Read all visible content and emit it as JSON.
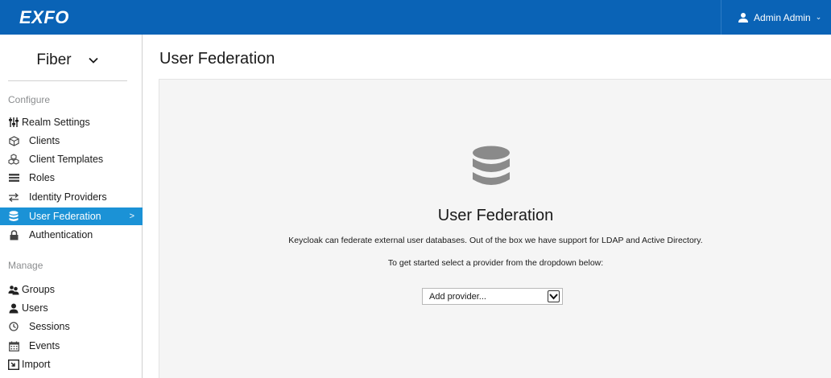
{
  "header": {
    "brand": "EXFO",
    "user_label": "Admin Admin",
    "caret": "⌄"
  },
  "sidebar": {
    "realm": "Fiber",
    "configure_label": "Configure",
    "configure_items": [
      {
        "label": "Realm Settings",
        "icon": "sliders-icon"
      },
      {
        "label": "Clients",
        "icon": "cube-icon"
      },
      {
        "label": "Client Templates",
        "icon": "cubes-icon"
      },
      {
        "label": "Roles",
        "icon": "list-icon"
      },
      {
        "label": "Identity Providers",
        "icon": "exchange-icon"
      },
      {
        "label": "User Federation",
        "icon": "database-icon",
        "active": true
      },
      {
        "label": "Authentication",
        "icon": "lock-icon"
      }
    ],
    "manage_label": "Manage",
    "manage_items": [
      {
        "label": "Groups",
        "icon": "users-icon"
      },
      {
        "label": "Users",
        "icon": "user-icon"
      },
      {
        "label": "Sessions",
        "icon": "clock-icon"
      },
      {
        "label": "Events",
        "icon": "calendar-icon"
      },
      {
        "label": "Import",
        "icon": "import-icon"
      }
    ],
    "active_chevron": ">"
  },
  "main": {
    "title": "User Federation",
    "panel_title": "User Federation",
    "panel_text1": "Keycloak can federate external user databases. Out of the box we have support for LDAP and Active Directory.",
    "panel_text2": "To get started select a provider from the dropdown below:",
    "select_value": "Add provider..."
  },
  "colors": {
    "navbar": "#0a63b6",
    "active": "#1b92d6",
    "panel": "#f5f5f5"
  }
}
